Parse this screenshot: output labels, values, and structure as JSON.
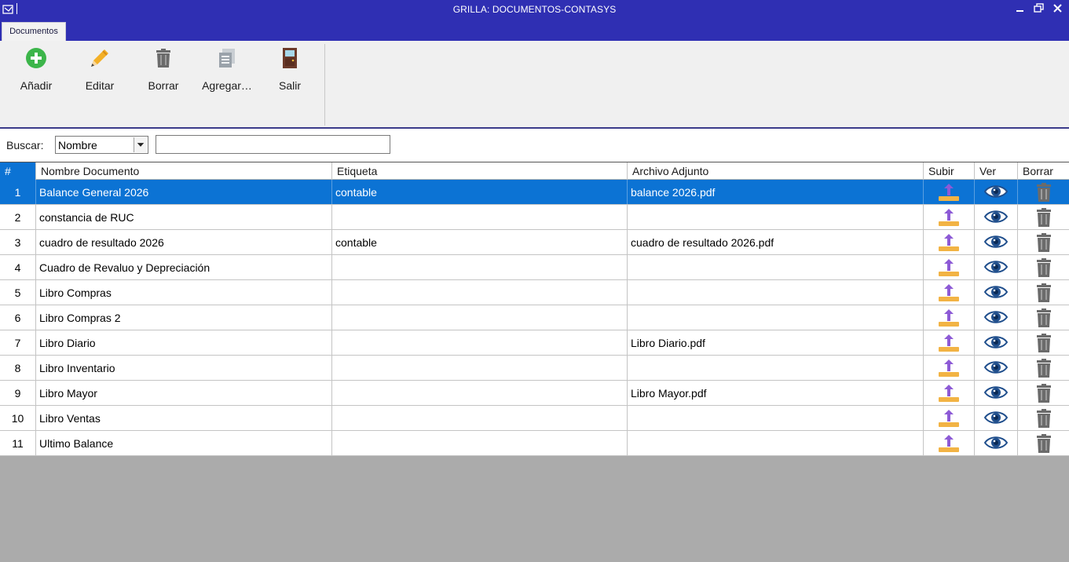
{
  "window": {
    "title": "GRILLA: DOCUMENTOS-CONTASYS",
    "controls": {
      "minimize": "minimize-icon",
      "maximize": "restore-icon",
      "close": "close-icon"
    }
  },
  "ribbon": {
    "tab": "Documentos",
    "buttons": [
      {
        "label": "Añadir",
        "icon": "add-icon",
        "color": "#3cb54a"
      },
      {
        "label": "Editar",
        "icon": "pencil-icon",
        "color": "#f3b027"
      },
      {
        "label": "Borrar",
        "icon": "trash-icon",
        "color": "#6b6b6b"
      },
      {
        "label": "Agregar…",
        "icon": "documents-icon",
        "color": "#9aa2aa"
      },
      {
        "label": "Salir",
        "icon": "door-icon",
        "color": "#6b3a2a"
      }
    ]
  },
  "search": {
    "label": "Buscar:",
    "field_selected": "Nombre",
    "value": ""
  },
  "grid": {
    "columns": [
      "#",
      "Nombre Documento",
      "Etiqueta",
      "Archivo Adjunto",
      "Subir",
      "Ver",
      "Borrar"
    ],
    "selected_row": 0,
    "rows": [
      {
        "num": "1",
        "name": "Balance General 2026",
        "tag": "contable",
        "file": "balance 2026.pdf"
      },
      {
        "num": "2",
        "name": "constancia de RUC",
        "tag": "",
        "file": ""
      },
      {
        "num": "3",
        "name": "cuadro de resultado 2026",
        "tag": "contable",
        "file": "cuadro de resultado 2026.pdf"
      },
      {
        "num": "4",
        "name": "Cuadro de Revaluo y Depreciación",
        "tag": "",
        "file": ""
      },
      {
        "num": "5",
        "name": "Libro Compras",
        "tag": "",
        "file": ""
      },
      {
        "num": "6",
        "name": "Libro Compras 2",
        "tag": "",
        "file": ""
      },
      {
        "num": "7",
        "name": "Libro Diario",
        "tag": "",
        "file": "Libro Diario.pdf"
      },
      {
        "num": "8",
        "name": "Libro Inventario",
        "tag": "",
        "file": ""
      },
      {
        "num": "9",
        "name": "Libro Mayor",
        "tag": "",
        "file": "Libro Mayor.pdf"
      },
      {
        "num": "10",
        "name": "Libro Ventas",
        "tag": "",
        "file": ""
      },
      {
        "num": "11",
        "name": "Ultimo Balance",
        "tag": "",
        "file": ""
      }
    ],
    "row_icons": {
      "upload": "upload-icon",
      "view": "eye-icon",
      "delete": "trash-icon"
    }
  },
  "colors": {
    "titlebar": "#2f2fb3",
    "selection": "#0c73d4",
    "background": "#ababab"
  }
}
